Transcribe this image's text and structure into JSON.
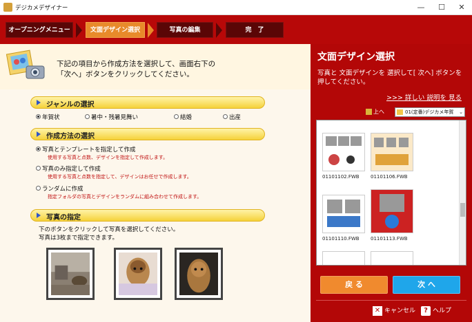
{
  "window": {
    "title": "デジカメデザイナー",
    "min": "—",
    "max": "☐",
    "close": "✕"
  },
  "steps": [
    {
      "label": "オープニングメニュー",
      "state": "done"
    },
    {
      "label": "文面デザイン選択",
      "state": "active"
    },
    {
      "label": "写真の編集",
      "state": "todo"
    },
    {
      "label": "完　了",
      "state": "todo"
    }
  ],
  "intro": {
    "line1": "下記の項目から作成方法を選択して、画面右下の",
    "line2": "「次へ」ボタンをクリックしてください。"
  },
  "genre": {
    "title": "ジャンルの選択",
    "options": [
      "年賀状",
      "暑中・残暑見舞い",
      "結婚",
      "出産"
    ],
    "selected": 0
  },
  "method": {
    "title": "作成方法の選択",
    "options": [
      {
        "label": "写真とテンプレートを指定して作成",
        "desc": "使用する写真と点数、デザインを指定して作成します。",
        "selected": true
      },
      {
        "label": "写真のみ指定して作成",
        "desc": "使用する写真と点数を指定して、デザインはお任せで作成します。",
        "selected": false
      },
      {
        "label": "ランダムに作成",
        "desc": "指定フォルダの写真とデザインをランダムに組み合わせて作成します。",
        "selected": false
      }
    ]
  },
  "photos": {
    "title": "写真の指定",
    "line1": "下のボタンをクリックして写真を選択してください。",
    "line2": "写真は3枚まで指定できます。"
  },
  "right": {
    "title": "文面デザイン選択",
    "desc": "写真と 文面デザインを 選択して[ 次へ] ボタンを 押してください。",
    "link": ">>> 詳しい 説明を 見る",
    "up_label": "上へ",
    "folder": "01(定番)デジカメ年賀",
    "files": [
      "01101102.FWB",
      "01101106.FWB",
      "01101110.FWB",
      "01101113.FWB"
    ],
    "back": "戻 る",
    "next": "次 へ",
    "cancel": "キャンセル",
    "help": "ヘルプ"
  },
  "colors": {
    "accent_red": "#b70808",
    "active_orange": "#e88a2a",
    "next_blue": "#1fa6ea"
  }
}
